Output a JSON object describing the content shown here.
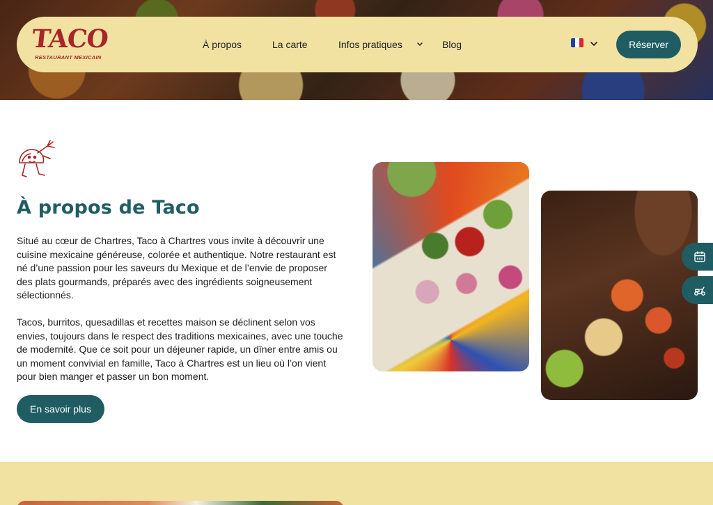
{
  "brand": {
    "name": "TACO",
    "tagline": "RESTAURANT MEXICAIN",
    "primary_color": "#1f5d63",
    "logo_color": "#a8262a",
    "nav_bg": "#f1e2a2"
  },
  "nav": {
    "links": [
      {
        "label": "À propos"
      },
      {
        "label": "La carte"
      },
      {
        "label": "Infos pratiques",
        "has_dropdown": true
      },
      {
        "label": "Blog"
      }
    ],
    "language": {
      "icon": "france-flag-icon",
      "selected": "fr"
    },
    "reserve_button": "Réserver"
  },
  "about": {
    "mascot_icon": "taco-mascot-icon",
    "title_part1": "À ",
    "title_bold1": "prop",
    "title_part2": "os de ",
    "title_bold2": "T",
    "title_part3": "aco",
    "paragraph_1": "Situé au cœur de Chartres, Taco à Chartres vous invite à découvrir une cuisine mexicaine généreuse, colorée et authentique. Notre restaurant est né d’une passion pour les saveurs du Mexique et de l’envie de proposer des plats gourmands, préparés avec des ingrédients soigneusement sélectionnés.",
    "paragraph_2": "Tacos, burritos, quesadillas et recettes maison se déclinent selon vos envies, toujours dans le respect des traditions mexicaines, avec une touche de modernité. Que ce soit pour un déjeuner rapide, un dîner entre amis ou un moment convivial en famille, Taco à Chartres est un lieu où l’on vient pour bien manger et passer un bon moment.",
    "cta_button": "En savoir plus"
  },
  "side_tabs": [
    {
      "icon": "calendar-icon"
    },
    {
      "icon": "delivery-scooter-icon"
    }
  ]
}
